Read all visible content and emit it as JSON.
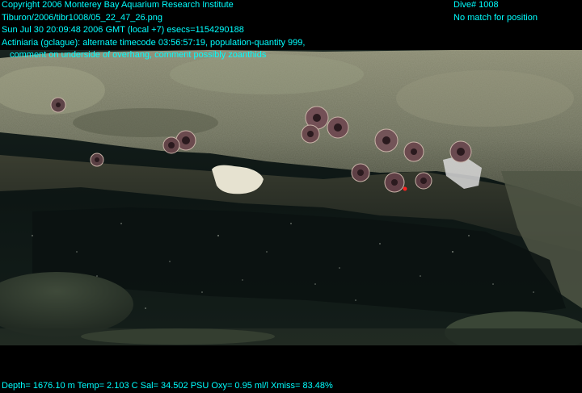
{
  "overlay": {
    "copyright": "Copyright 2006 Monterey Bay Aquarium Research Institute",
    "file_path": "Tiburon/2006/tibr1008/05_22_47_26.png",
    "datetime": "Sun Jul 30 20:09:48 2006 GMT (local +7)  esecs=1154290188",
    "annotation_line1": "Actiniaria (gclague): alternate timecode 03:56:57:19, population-quantity 999,",
    "annotation_line2": "comment on underside of overhang, comment possibly zoanthids",
    "dive": "Dive# 1008",
    "position_status": "No match for position",
    "telemetry": "Depth= 1676.10 m  Temp= 2.103 C  Sal= 34.502 PSU  Oxy= 0.95 ml/l  Xmiss= 83.48%"
  },
  "colors": {
    "overlay_text": "#00ffff",
    "background": "#000000",
    "rock_light": "#8a8b72",
    "rock_dark": "#2f3428",
    "water": "#0f1a18"
  }
}
